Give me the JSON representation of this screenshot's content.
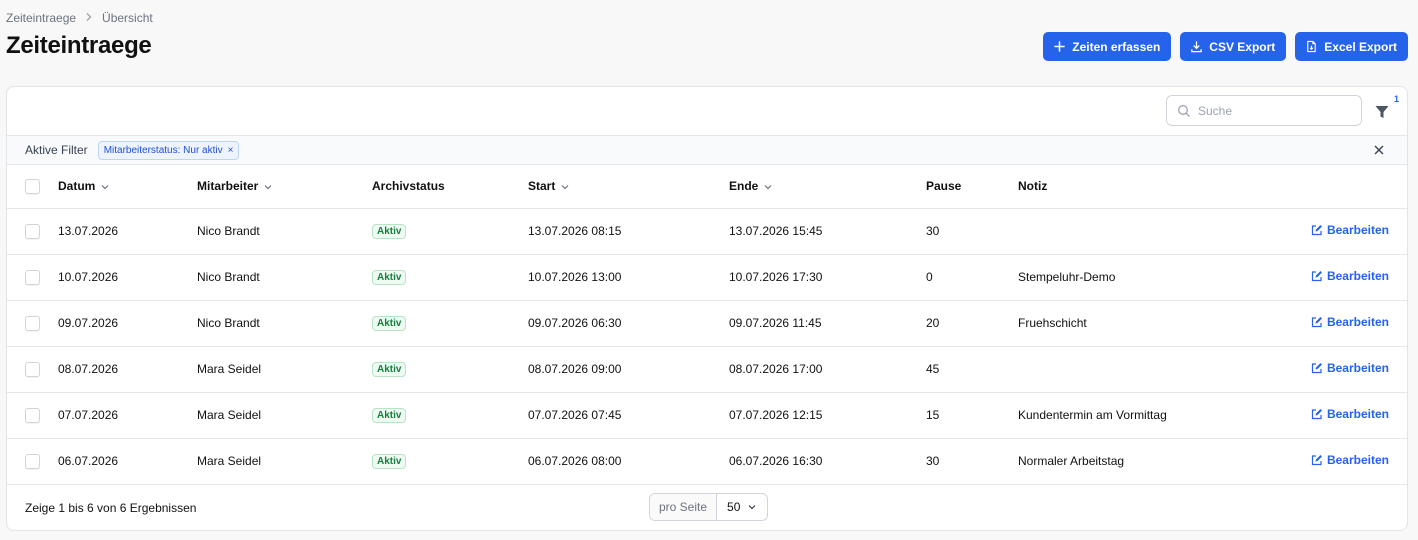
{
  "breadcrumb": {
    "parent": "Zeiteintraege",
    "current": "Übersicht"
  },
  "page": {
    "title": "Zeiteintraege"
  },
  "actions": {
    "create_label": "Zeiten erfassen",
    "csv_label": "CSV Export",
    "excel_label": "Excel Export"
  },
  "colors": {
    "primary": "#2563eb",
    "success": "#15803d",
    "border": "#e5e7eb"
  },
  "toolbar": {
    "search_placeholder": "Suche",
    "search_value": "",
    "filter_count": "1"
  },
  "filters": {
    "label": "Aktive Filter",
    "chips": [
      "Mitarbeiterstatus: Nur aktiv"
    ]
  },
  "table": {
    "columns": {
      "datum": "Datum",
      "mitarbeiter": "Mitarbeiter",
      "archivstatus": "Archivstatus",
      "start": "Start",
      "ende": "Ende",
      "pause": "Pause",
      "notiz": "Notiz"
    },
    "edit_label": "Bearbeiten",
    "rows": [
      {
        "datum": "13.07.2026",
        "mitarbeiter": "Nico Brandt",
        "status": "Aktiv",
        "start": "13.07.2026 08:15",
        "ende": "13.07.2026 15:45",
        "pause": "30",
        "notiz": ""
      },
      {
        "datum": "10.07.2026",
        "mitarbeiter": "Nico Brandt",
        "status": "Aktiv",
        "start": "10.07.2026 13:00",
        "ende": "10.07.2026 17:30",
        "pause": "0",
        "notiz": "Stempeluhr-Demo"
      },
      {
        "datum": "09.07.2026",
        "mitarbeiter": "Nico Brandt",
        "status": "Aktiv",
        "start": "09.07.2026 06:30",
        "ende": "09.07.2026 11:45",
        "pause": "20",
        "notiz": "Fruehschicht"
      },
      {
        "datum": "08.07.2026",
        "mitarbeiter": "Mara Seidel",
        "status": "Aktiv",
        "start": "08.07.2026 09:00",
        "ende": "08.07.2026 17:00",
        "pause": "45",
        "notiz": ""
      },
      {
        "datum": "07.07.2026",
        "mitarbeiter": "Mara Seidel",
        "status": "Aktiv",
        "start": "07.07.2026 07:45",
        "ende": "07.07.2026 12:15",
        "pause": "15",
        "notiz": "Kundentermin am Vormittag"
      },
      {
        "datum": "06.07.2026",
        "mitarbeiter": "Mara Seidel",
        "status": "Aktiv",
        "start": "06.07.2026 08:00",
        "ende": "06.07.2026 16:30",
        "pause": "30",
        "notiz": "Normaler Arbeitstag"
      }
    ]
  },
  "footer": {
    "results_text": "Zeige 1 bis 6 von 6 Ergebnissen",
    "per_page_label": "pro Seite",
    "per_page_value": "50"
  }
}
